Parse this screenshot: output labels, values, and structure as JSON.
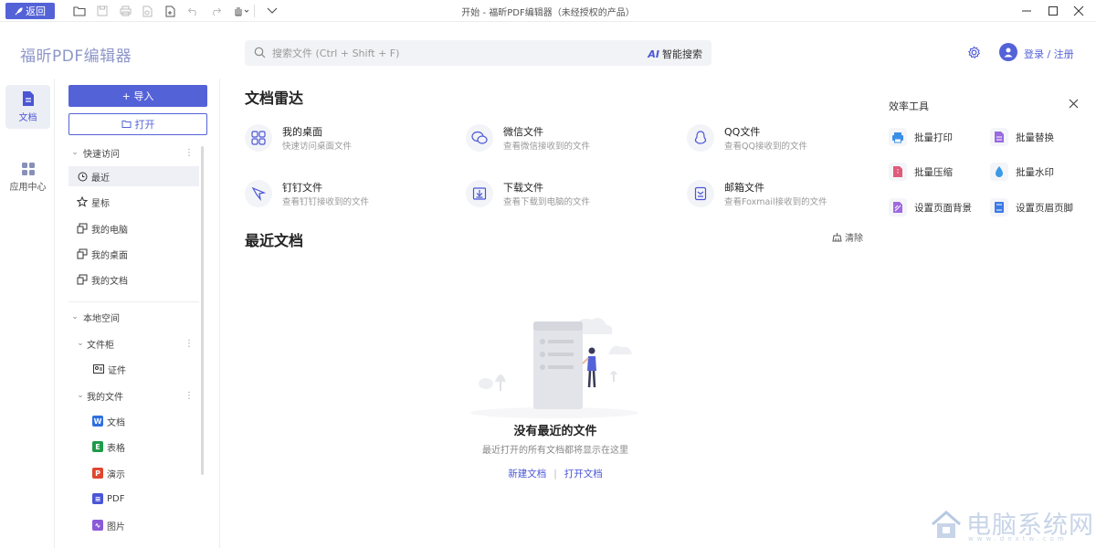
{
  "titlebar": {
    "back_label": "返回",
    "window_title": "开始 - 福昕PDF编辑器（未经授权的产品）"
  },
  "header": {
    "app_name": "福昕PDF编辑器",
    "search_placeholder": "搜索文件 (Ctrl + Shift + F)",
    "smart_search_label": "智能搜索",
    "login_label": "登录 / 注册"
  },
  "rail": {
    "items": [
      {
        "label": "文档"
      },
      {
        "label": "应用中心"
      }
    ]
  },
  "sidebar": {
    "import_label": "+ 导入",
    "open_label": "打开",
    "quick_access_label": "快速访问",
    "quick_access_items": [
      {
        "label": "最近"
      },
      {
        "label": "星标"
      },
      {
        "label": "我的电脑"
      },
      {
        "label": "我的桌面"
      },
      {
        "label": "我的文档"
      }
    ],
    "local_space_label": "本地空间",
    "cabinet_label": "文件柜",
    "cabinet_items": [
      {
        "label": "证件"
      }
    ],
    "my_files_label": "我的文件",
    "my_files_items": [
      {
        "label": "文档",
        "badge": "W",
        "color": "#2f6fe0"
      },
      {
        "label": "表格",
        "badge": "E",
        "color": "#1e9a4a"
      },
      {
        "label": "演示",
        "badge": "P",
        "color": "#e0462f"
      },
      {
        "label": "PDF",
        "badge": "≡",
        "color": "#4a56d6"
      },
      {
        "label": "图片",
        "badge": "∿",
        "color": "#8a5ad8"
      }
    ]
  },
  "main": {
    "radar_title": "文档雷达",
    "radar_items": [
      {
        "title": "我的桌面",
        "desc": "快速访问桌面文件"
      },
      {
        "title": "微信文件",
        "desc": "查看微信接收到的文件"
      },
      {
        "title": "QQ文件",
        "desc": "查看QQ接收到的文件"
      },
      {
        "title": "钉钉文件",
        "desc": "查看钉钉接收到的文件"
      },
      {
        "title": "下载文件",
        "desc": "查看下载到电脑的文件"
      },
      {
        "title": "邮箱文件",
        "desc": "查看Foxmail接收到的文件"
      }
    ],
    "recent_title": "最近文档",
    "clear_label": "清除",
    "empty_title": "没有最近的文件",
    "empty_desc": "最近打开的所有文档都将显示在这里",
    "new_doc_label": "新建文档",
    "open_doc_label": "打开文档"
  },
  "tools": {
    "title": "效率工具",
    "items": [
      {
        "label": "批量打印",
        "color": "#3a8ee6"
      },
      {
        "label": "批量替换",
        "color": "#9a6ae0"
      },
      {
        "label": "批量压缩",
        "color": "#e05a7a"
      },
      {
        "label": "批量水印",
        "color": "#3a9ae6"
      },
      {
        "label": "设置页面背景",
        "color": "#a06ae0"
      },
      {
        "label": "设置页眉页脚",
        "color": "#3a7ae6"
      }
    ]
  },
  "watermark": {
    "text": "电脑系统网",
    "sub": "www.dnxtw.com"
  },
  "colors": {
    "accent": "#5462d8",
    "logo": "#8d96c9"
  }
}
